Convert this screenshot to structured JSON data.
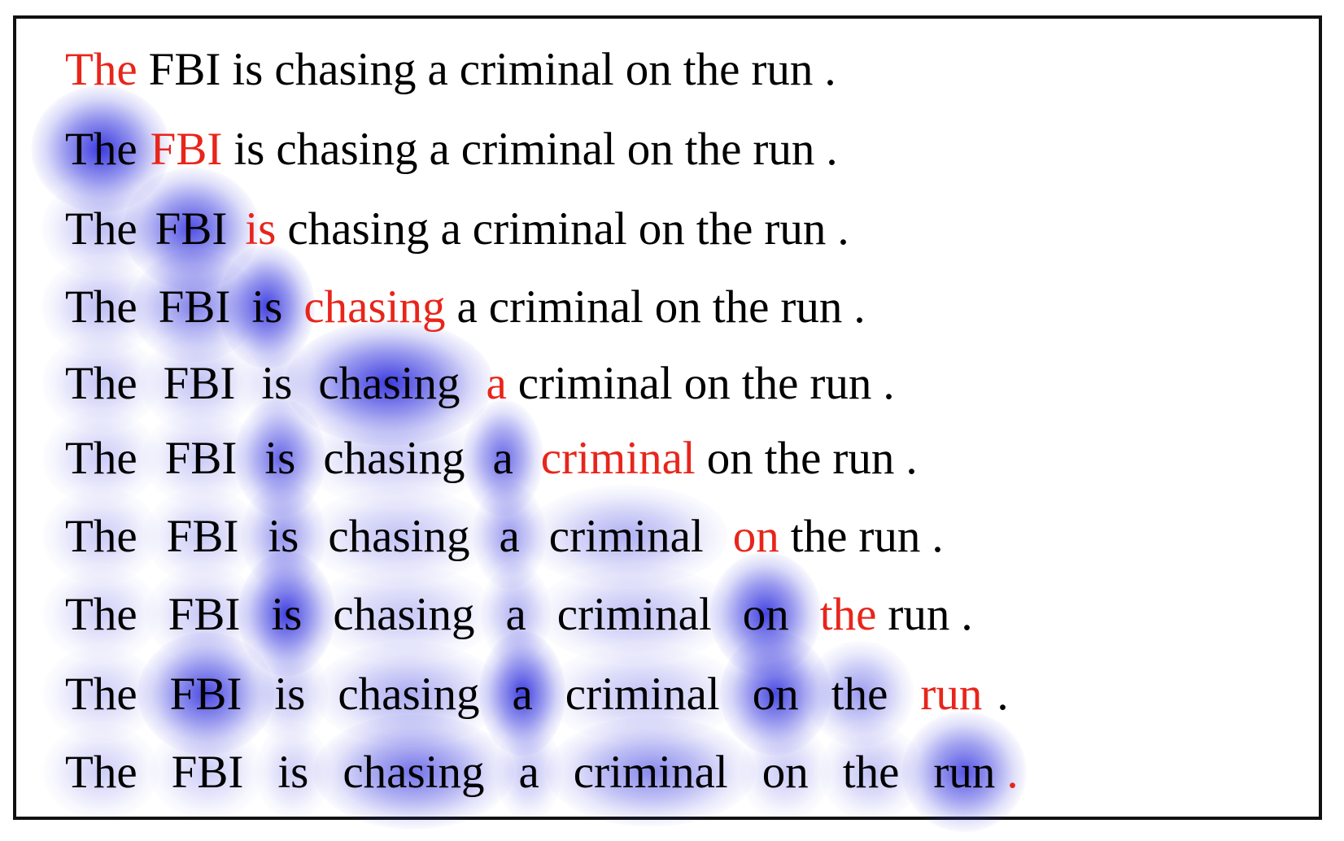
{
  "figure": {
    "kind": "attention-visualization",
    "colors": {
      "text": "#000000",
      "generated_token": "#E8251B",
      "attention_glow": "#3B3BE0",
      "frame": "#111111",
      "background": "#FFFFFF"
    },
    "tokens": [
      "The",
      "FBI",
      "is",
      "chasing",
      "a",
      "criminal",
      "on",
      "the",
      "run",
      "."
    ],
    "rows": [
      {
        "index": 1,
        "tokens": [
          {
            "text": "The",
            "color": "red",
            "attention": 0.0
          },
          {
            "text": "FBI",
            "color": "black",
            "attention": 0.0
          },
          {
            "text": "is",
            "color": "black",
            "attention": 0.0
          },
          {
            "text": "chasing",
            "color": "black",
            "attention": 0.0
          },
          {
            "text": "a",
            "color": "black",
            "attention": 0.0
          },
          {
            "text": "criminal",
            "color": "black",
            "attention": 0.0
          },
          {
            "text": "on",
            "color": "black",
            "attention": 0.0
          },
          {
            "text": "the",
            "color": "black",
            "attention": 0.0
          },
          {
            "text": "run",
            "color": "black",
            "attention": 0.0
          },
          {
            "text": ".",
            "color": "black",
            "attention": 0.0
          }
        ]
      },
      {
        "index": 2,
        "tokens": [
          {
            "text": "The",
            "color": "black",
            "attention": 0.95
          },
          {
            "text": "FBI",
            "color": "red",
            "attention": 0.0
          },
          {
            "text": "is",
            "color": "black",
            "attention": 0.0
          },
          {
            "text": "chasing",
            "color": "black",
            "attention": 0.0
          },
          {
            "text": "a",
            "color": "black",
            "attention": 0.0
          },
          {
            "text": "criminal",
            "color": "black",
            "attention": 0.0
          },
          {
            "text": "on",
            "color": "black",
            "attention": 0.0
          },
          {
            "text": "the",
            "color": "black",
            "attention": 0.0
          },
          {
            "text": "run",
            "color": "black",
            "attention": 0.0
          },
          {
            "text": ".",
            "color": "black",
            "attention": 0.0
          }
        ]
      },
      {
        "index": 3,
        "tokens": [
          {
            "text": "The",
            "color": "black",
            "attention": 0.22
          },
          {
            "text": "FBI",
            "color": "black",
            "attention": 0.82
          },
          {
            "text": "is",
            "color": "red",
            "attention": 0.0
          },
          {
            "text": "chasing",
            "color": "black",
            "attention": 0.0
          },
          {
            "text": "a",
            "color": "black",
            "attention": 0.0
          },
          {
            "text": "criminal",
            "color": "black",
            "attention": 0.0
          },
          {
            "text": "on",
            "color": "black",
            "attention": 0.0
          },
          {
            "text": "the",
            "color": "black",
            "attention": 0.0
          },
          {
            "text": "run",
            "color": "black",
            "attention": 0.0
          },
          {
            "text": ".",
            "color": "black",
            "attention": 0.0
          }
        ]
      },
      {
        "index": 4,
        "tokens": [
          {
            "text": "The",
            "color": "black",
            "attention": 0.22
          },
          {
            "text": "FBI",
            "color": "black",
            "attention": 0.55
          },
          {
            "text": "is",
            "color": "black",
            "attention": 0.88
          },
          {
            "text": "chasing",
            "color": "red",
            "attention": 0.0
          },
          {
            "text": "a",
            "color": "black",
            "attention": 0.0
          },
          {
            "text": "criminal",
            "color": "black",
            "attention": 0.0
          },
          {
            "text": "on",
            "color": "black",
            "attention": 0.0
          },
          {
            "text": "the",
            "color": "black",
            "attention": 0.0
          },
          {
            "text": "run",
            "color": "black",
            "attention": 0.0
          },
          {
            "text": ".",
            "color": "black",
            "attention": 0.0
          }
        ]
      },
      {
        "index": 5,
        "tokens": [
          {
            "text": "The",
            "color": "black",
            "attention": 0.18
          },
          {
            "text": "FBI",
            "color": "black",
            "attention": 0.2
          },
          {
            "text": "is",
            "color": "black",
            "attention": 0.1
          },
          {
            "text": "chasing",
            "color": "black",
            "attention": 0.92
          },
          {
            "text": "a",
            "color": "red",
            "attention": 0.0
          },
          {
            "text": "criminal",
            "color": "black",
            "attention": 0.0
          },
          {
            "text": "on",
            "color": "black",
            "attention": 0.0
          },
          {
            "text": "the",
            "color": "black",
            "attention": 0.0
          },
          {
            "text": "run",
            "color": "black",
            "attention": 0.0
          },
          {
            "text": ".",
            "color": "black",
            "attention": 0.0
          }
        ]
      },
      {
        "index": 6,
        "tokens": [
          {
            "text": "The",
            "color": "black",
            "attention": 0.15
          },
          {
            "text": "FBI",
            "color": "black",
            "attention": 0.15
          },
          {
            "text": "is",
            "color": "black",
            "attention": 0.7
          },
          {
            "text": "chasing",
            "color": "black",
            "attention": 0.18
          },
          {
            "text": "a",
            "color": "black",
            "attention": 0.68
          },
          {
            "text": "criminal",
            "color": "red",
            "attention": 0.0
          },
          {
            "text": "on",
            "color": "black",
            "attention": 0.0
          },
          {
            "text": "the",
            "color": "black",
            "attention": 0.0
          },
          {
            "text": "run",
            "color": "black",
            "attention": 0.0
          },
          {
            "text": ".",
            "color": "black",
            "attention": 0.0
          }
        ]
      },
      {
        "index": 7,
        "tokens": [
          {
            "text": "The",
            "color": "black",
            "attention": 0.15
          },
          {
            "text": "FBI",
            "color": "black",
            "attention": 0.16
          },
          {
            "text": "is",
            "color": "black",
            "attention": 0.45
          },
          {
            "text": "chasing",
            "color": "black",
            "attention": 0.2
          },
          {
            "text": "a",
            "color": "black",
            "attention": 0.42
          },
          {
            "text": "criminal",
            "color": "black",
            "attention": 0.3
          },
          {
            "text": "on",
            "color": "red",
            "attention": 0.0
          },
          {
            "text": "the",
            "color": "black",
            "attention": 0.0
          },
          {
            "text": "run",
            "color": "black",
            "attention": 0.0
          },
          {
            "text": ".",
            "color": "black",
            "attention": 0.0
          }
        ]
      },
      {
        "index": 8,
        "tokens": [
          {
            "text": "The",
            "color": "black",
            "attention": 0.14
          },
          {
            "text": "FBI",
            "color": "black",
            "attention": 0.18
          },
          {
            "text": "is",
            "color": "black",
            "attention": 0.9
          },
          {
            "text": "chasing",
            "color": "black",
            "attention": 0.18
          },
          {
            "text": "a",
            "color": "black",
            "attention": 0.3
          },
          {
            "text": "criminal",
            "color": "black",
            "attention": 0.22
          },
          {
            "text": "on",
            "color": "black",
            "attention": 0.88
          },
          {
            "text": "the",
            "color": "red",
            "attention": 0.0
          },
          {
            "text": "run",
            "color": "black",
            "attention": 0.0
          },
          {
            "text": ".",
            "color": "black",
            "attention": 0.0
          }
        ]
      },
      {
        "index": 9,
        "tokens": [
          {
            "text": "The",
            "color": "black",
            "attention": 0.14
          },
          {
            "text": "FBI",
            "color": "black",
            "attention": 0.85
          },
          {
            "text": "is",
            "color": "black",
            "attention": 0.2
          },
          {
            "text": "chasing",
            "color": "black",
            "attention": 0.32
          },
          {
            "text": "a",
            "color": "black",
            "attention": 0.9
          },
          {
            "text": "criminal",
            "color": "black",
            "attention": 0.2
          },
          {
            "text": "on",
            "color": "black",
            "attention": 0.85
          },
          {
            "text": "the",
            "color": "black",
            "attention": 0.4
          },
          {
            "text": "run",
            "color": "red",
            "attention": 0.0
          },
          {
            "text": ".",
            "color": "black",
            "attention": 0.0
          }
        ]
      },
      {
        "index": 10,
        "tokens": [
          {
            "text": "The",
            "color": "black",
            "attention": 0.14
          },
          {
            "text": "FBI",
            "color": "black",
            "attention": 0.14
          },
          {
            "text": "is",
            "color": "black",
            "attention": 0.14
          },
          {
            "text": "chasing",
            "color": "black",
            "attention": 0.62
          },
          {
            "text": "a",
            "color": "black",
            "attention": 0.2
          },
          {
            "text": "criminal",
            "color": "black",
            "attention": 0.5
          },
          {
            "text": "on",
            "color": "black",
            "attention": 0.16
          },
          {
            "text": "the",
            "color": "black",
            "attention": 0.2
          },
          {
            "text": "run",
            "color": "black",
            "attention": 0.78
          },
          {
            "text": ".",
            "color": "red",
            "attention": 0.0
          }
        ]
      }
    ]
  }
}
